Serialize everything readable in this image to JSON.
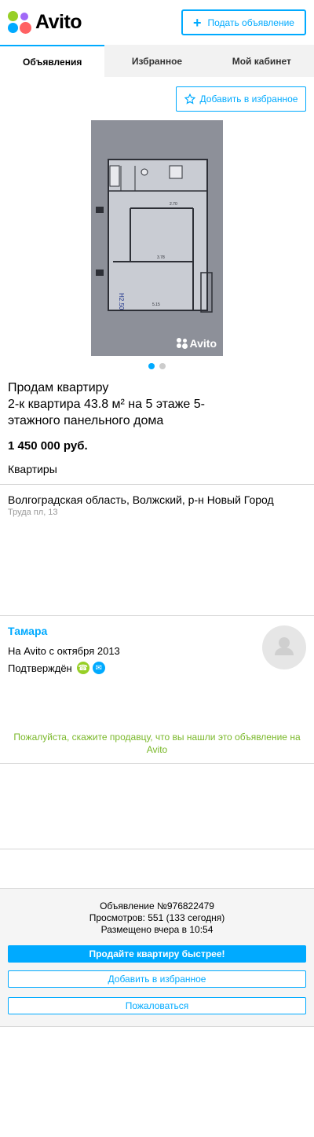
{
  "header": {
    "logo_text": "Avito",
    "post_button": "Подать объявление"
  },
  "tabs": [
    {
      "label": "Объявления",
      "active": true
    },
    {
      "label": "Избранное",
      "active": false
    },
    {
      "label": "Мой кабинет",
      "active": false
    }
  ],
  "add_favorite_top": "Добавить в избранное",
  "photo": {
    "watermark": "Avito",
    "pages": 2,
    "current_page": 1,
    "plan_labels": [
      "2.70",
      "3.78",
      "5.15",
      "H2.50"
    ]
  },
  "listing": {
    "title": "Продам квартиру\n2-к квартира 43.8 м² на 5 этаже 5-этажного панельного дома",
    "price": "1 450 000 руб.",
    "category": "Квартиры",
    "address": "Волгоградская область, Волжский, р-н Новый Город",
    "street": "Труда пл, 13"
  },
  "seller": {
    "name": "Тамара",
    "since": "На Avito с октября 2013",
    "verified": "Подтверждён",
    "notice": "Пожалуйста, скажите продавцу, что вы нашли это объявление на Avito"
  },
  "footer": {
    "ad_number": "Объявление №976822479",
    "views": "Просмотров: 551 (133 сегодня)",
    "posted": "Размещено вчера в 10:54",
    "sell_faster_button": "Продайте квартиру быстрее!",
    "add_favorite_button": "Добавить в избранное",
    "report_button": "Пожаловаться"
  },
  "colors": {
    "accent": "#00aaff",
    "green": "#97cf26",
    "notice_green": "#7ab82a"
  }
}
